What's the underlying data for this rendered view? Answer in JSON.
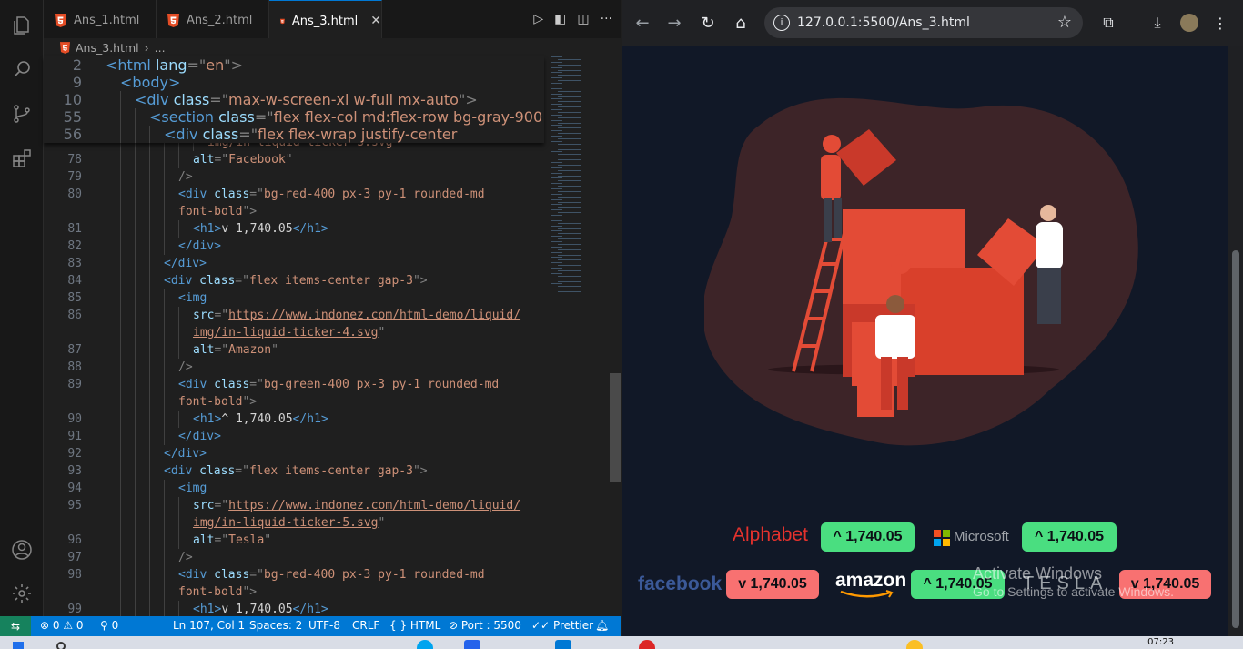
{
  "vscode": {
    "tabs": [
      {
        "label": "Ans_1.html",
        "active": false
      },
      {
        "label": "Ans_2.html",
        "active": false
      },
      {
        "label": "Ans_3.html",
        "active": true
      }
    ],
    "breadcrumb": {
      "file": "Ans_3.html",
      "more": "..."
    },
    "sticky_lines": [
      {
        "num": "2",
        "indent": 0,
        "tokens": [
          [
            "tg",
            "<html "
          ],
          [
            "at",
            "lang"
          ],
          [
            "pu",
            "=\""
          ],
          [
            "st",
            "en"
          ],
          [
            "pu",
            "\">"
          ]
        ]
      },
      {
        "num": "9",
        "indent": 1,
        "tokens": [
          [
            "tg",
            "<body>"
          ]
        ]
      },
      {
        "num": "10",
        "indent": 2,
        "tokens": [
          [
            "tg",
            "<div "
          ],
          [
            "at",
            "class"
          ],
          [
            "pu",
            "=\""
          ],
          [
            "st",
            "max-w-screen-xl w-full mx-auto"
          ],
          [
            "pu",
            "\">"
          ]
        ]
      },
      {
        "num": "55",
        "indent": 3,
        "tokens": [
          [
            "tg",
            "<section "
          ],
          [
            "at",
            "class"
          ],
          [
            "pu",
            "=\""
          ],
          [
            "st",
            "flex flex-col md:flex-row bg-gray-900"
          ]
        ]
      },
      {
        "num": "56",
        "indent": 4,
        "tokens": [
          [
            "tg",
            "<div "
          ],
          [
            "at",
            "class"
          ],
          [
            "pu",
            "=\""
          ],
          [
            "st",
            "flex flex-wrap justify-center"
          ]
        ]
      }
    ],
    "code_lines": [
      {
        "num": "",
        "indent": 7,
        "tokens": [
          [
            "st",
            "img/in-liquid-ticker-3.svg\""
          ]
        ]
      },
      {
        "num": "78",
        "indent": 6,
        "tokens": [
          [
            "at",
            "alt"
          ],
          [
            "pu",
            "=\""
          ],
          [
            "st",
            "Facebook"
          ],
          [
            "pu",
            "\""
          ]
        ]
      },
      {
        "num": "79",
        "indent": 5,
        "tokens": [
          [
            "pu",
            "/>"
          ]
        ]
      },
      {
        "num": "80",
        "indent": 5,
        "tokens": [
          [
            "tg",
            "<div "
          ],
          [
            "at",
            "class"
          ],
          [
            "pu",
            "=\""
          ],
          [
            "st",
            "bg-red-400 px-3 py-1 rounded-md"
          ]
        ]
      },
      {
        "num": "",
        "indent": 5,
        "tokens": [
          [
            "st",
            "font-bold"
          ],
          [
            "pu",
            "\">"
          ]
        ]
      },
      {
        "num": "81",
        "indent": 6,
        "tokens": [
          [
            "tg",
            "<h1>"
          ],
          [
            "tx",
            "v 1,740.05"
          ],
          [
            "tg",
            "</h1>"
          ]
        ]
      },
      {
        "num": "82",
        "indent": 5,
        "tokens": [
          [
            "tg",
            "</div>"
          ]
        ]
      },
      {
        "num": "83",
        "indent": 4,
        "tokens": [
          [
            "tg",
            "</div>"
          ]
        ]
      },
      {
        "num": "84",
        "indent": 4,
        "tokens": [
          [
            "tg",
            "<div "
          ],
          [
            "at",
            "class"
          ],
          [
            "pu",
            "=\""
          ],
          [
            "st",
            "flex items-center gap-3"
          ],
          [
            "pu",
            "\">"
          ]
        ]
      },
      {
        "num": "85",
        "indent": 5,
        "tokens": [
          [
            "tg",
            "<img"
          ]
        ]
      },
      {
        "num": "86",
        "indent": 6,
        "tokens": [
          [
            "at",
            "src"
          ],
          [
            "pu",
            "=\""
          ],
          [
            "stu",
            "https://www.indonez.com/html-demo/liquid/"
          ]
        ]
      },
      {
        "num": "",
        "indent": 6,
        "tokens": [
          [
            "stu",
            "img/in-liquid-ticker-4.svg"
          ],
          [
            "pu",
            "\""
          ]
        ]
      },
      {
        "num": "87",
        "indent": 6,
        "tokens": [
          [
            "at",
            "alt"
          ],
          [
            "pu",
            "=\""
          ],
          [
            "st",
            "Amazon"
          ],
          [
            "pu",
            "\""
          ]
        ]
      },
      {
        "num": "88",
        "indent": 5,
        "tokens": [
          [
            "pu",
            "/>"
          ]
        ]
      },
      {
        "num": "89",
        "indent": 5,
        "tokens": [
          [
            "tg",
            "<div "
          ],
          [
            "at",
            "class"
          ],
          [
            "pu",
            "=\""
          ],
          [
            "st",
            "bg-green-400 px-3 py-1 rounded-md"
          ]
        ]
      },
      {
        "num": "",
        "indent": 5,
        "tokens": [
          [
            "st",
            "font-bold"
          ],
          [
            "pu",
            "\">"
          ]
        ]
      },
      {
        "num": "90",
        "indent": 6,
        "tokens": [
          [
            "tg",
            "<h1>"
          ],
          [
            "tx",
            "^ 1,740.05"
          ],
          [
            "tg",
            "</h1>"
          ]
        ]
      },
      {
        "num": "91",
        "indent": 5,
        "tokens": [
          [
            "tg",
            "</div>"
          ]
        ]
      },
      {
        "num": "92",
        "indent": 4,
        "tokens": [
          [
            "tg",
            "</div>"
          ]
        ]
      },
      {
        "num": "93",
        "indent": 4,
        "tokens": [
          [
            "tg",
            "<div "
          ],
          [
            "at",
            "class"
          ],
          [
            "pu",
            "=\""
          ],
          [
            "st",
            "flex items-center gap-3"
          ],
          [
            "pu",
            "\">"
          ]
        ]
      },
      {
        "num": "94",
        "indent": 5,
        "tokens": [
          [
            "tg",
            "<img"
          ]
        ]
      },
      {
        "num": "95",
        "indent": 6,
        "tokens": [
          [
            "at",
            "src"
          ],
          [
            "pu",
            "=\""
          ],
          [
            "stu",
            "https://www.indonez.com/html-demo/liquid/"
          ]
        ]
      },
      {
        "num": "",
        "indent": 6,
        "tokens": [
          [
            "stu",
            "img/in-liquid-ticker-5.svg"
          ],
          [
            "pu",
            "\""
          ]
        ]
      },
      {
        "num": "96",
        "indent": 6,
        "tokens": [
          [
            "at",
            "alt"
          ],
          [
            "pu",
            "=\""
          ],
          [
            "st",
            "Tesla"
          ],
          [
            "pu",
            "\""
          ]
        ]
      },
      {
        "num": "97",
        "indent": 5,
        "tokens": [
          [
            "pu",
            "/>"
          ]
        ]
      },
      {
        "num": "98",
        "indent": 5,
        "tokens": [
          [
            "tg",
            "<div "
          ],
          [
            "at",
            "class"
          ],
          [
            "pu",
            "=\""
          ],
          [
            "st",
            "bg-red-400 px-3 py-1 rounded-md"
          ]
        ]
      },
      {
        "num": "",
        "indent": 5,
        "tokens": [
          [
            "st",
            "font-bold"
          ],
          [
            "pu",
            "\">"
          ]
        ]
      },
      {
        "num": "99",
        "indent": 6,
        "tokens": [
          [
            "tg",
            "<h1>"
          ],
          [
            "tx",
            "v 1,740.05"
          ],
          [
            "tg",
            "</h1>"
          ]
        ]
      }
    ],
    "status": {
      "problems": "0",
      "warnings": "0",
      "ports": "0",
      "position": "Ln 107, Col 1",
      "spaces": "Spaces: 2",
      "encoding": "UTF-8",
      "eol": "CRLF",
      "language": "HTML",
      "port": "Port : 5500",
      "formatter": "Prettier"
    }
  },
  "browser": {
    "url": "127.0.0.1:5500/Ans_3.html",
    "tickers": [
      {
        "brand": "Alphabet",
        "value": "^ 1,740.05",
        "trend": "up"
      },
      {
        "brand": "Microsoft",
        "value": "^ 1,740.05",
        "trend": "up"
      },
      {
        "brand": "facebook",
        "value": "v 1,740.05",
        "trend": "down"
      },
      {
        "brand": "amazon",
        "value": "^ 1,740.05",
        "trend": "up"
      },
      {
        "brand": "TESLA",
        "value": "v 1,740.05",
        "trend": "down"
      }
    ],
    "watermark": {
      "line1": "Activate Windows",
      "line2": "Go to Settings to activate Windows."
    }
  },
  "taskbar": {
    "time": "07:23"
  },
  "colors": {
    "up": "#4ade80",
    "down": "#f87171",
    "accent": "#0078d4",
    "page_bg": "#111827"
  }
}
